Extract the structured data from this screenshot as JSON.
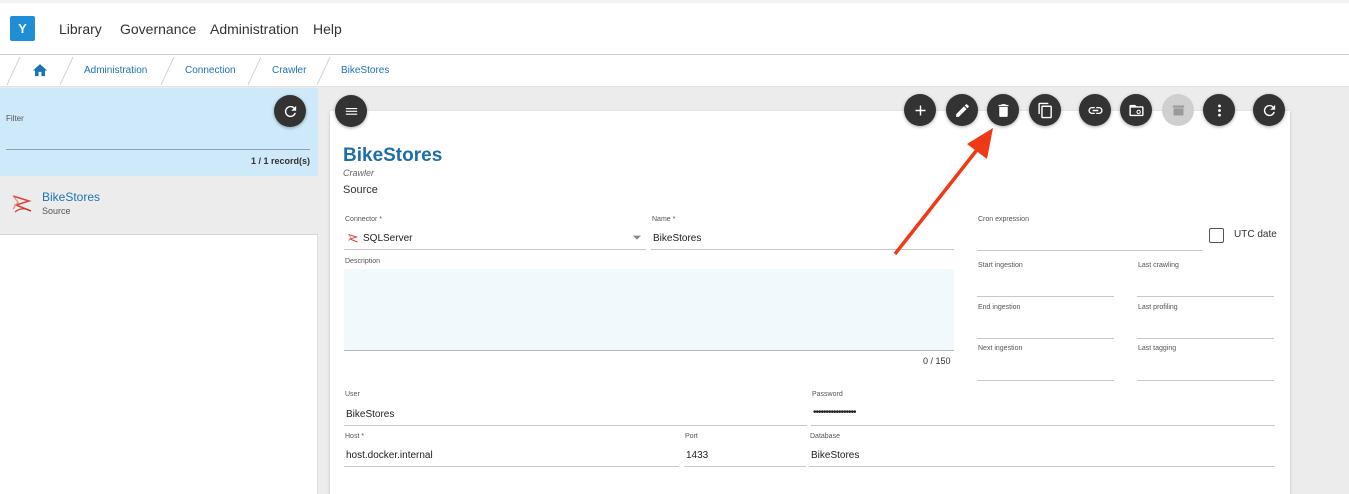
{
  "topbar": {
    "logo": "Y",
    "menu": [
      "Library",
      "Governance",
      "Administration",
      "Help"
    ]
  },
  "breadcrumb": {
    "home_icon": "home-icon",
    "items": [
      "Administration",
      "Connection",
      "Crawler",
      "BikeStores"
    ]
  },
  "left": {
    "filter_label": "Filter",
    "record_count": "1 / 1 record(s)",
    "items": [
      {
        "title": "BikeStores",
        "subtitle": "Source"
      }
    ]
  },
  "card": {
    "title": "BikeStores",
    "type": "Crawler",
    "subtitle": "Source",
    "connector": {
      "label": "Connector *",
      "value": "SQLServer"
    },
    "name": {
      "label": "Name *",
      "value": "BikeStores"
    },
    "description": {
      "label": "Description",
      "counter": "0 / 150"
    },
    "cron": {
      "label": "Cron expression",
      "value": ""
    },
    "utc": {
      "label": "UTC date",
      "checked": false
    },
    "start_ingestion": "Start ingestion",
    "last_crawling": "Last crawling",
    "end_ingestion": "End ingestion",
    "last_profiling": "Last profiling",
    "next_ingestion": "Next ingestion",
    "last_tagging": "Last tagging",
    "user": {
      "label": "User",
      "value": "BikeStores"
    },
    "password": {
      "label": "Password",
      "value": "•••••••••••••••••"
    },
    "host": {
      "label": "Host *",
      "value": "host.docker.internal"
    },
    "port": {
      "label": "Port",
      "value": "1433"
    },
    "database": {
      "label": "Database",
      "value": "BikeStores"
    }
  },
  "colors": {
    "accent": "#1e6ea8",
    "filter_bg": "#cde9fa",
    "button": "#333333",
    "arrow": "#f03a17"
  }
}
